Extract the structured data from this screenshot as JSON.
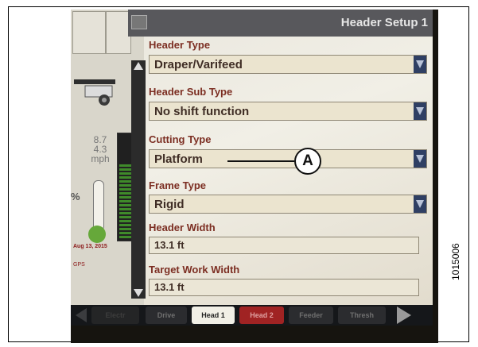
{
  "window": {
    "title": "Header Setup 1"
  },
  "gauges": {
    "speed_top": "8.7",
    "speed_bottom": "4.3",
    "speed_unit": "mph",
    "percent_partial": "%",
    "date": "Aug 13, 2015",
    "gps": "GPS"
  },
  "form": {
    "header_type": {
      "label": "Header Type",
      "value": "Draper/Varifeed"
    },
    "header_sub_type": {
      "label": "Header Sub Type",
      "value": "No shift function"
    },
    "cutting_type": {
      "label": "Cutting Type",
      "value": "Platform"
    },
    "frame_type": {
      "label": "Frame Type",
      "value": "Rigid"
    },
    "header_width": {
      "label": "Header Width",
      "value": "13.1  ft"
    },
    "target_work_width": {
      "label": "Target Work Width",
      "value": "13.1  ft"
    }
  },
  "tabs": [
    "Electr",
    "Drive",
    "Head 1",
    "Head 2",
    "Feeder",
    "Thresh"
  ],
  "active_tab": "Head 1",
  "callout": {
    "label": "A"
  },
  "figure_number": "1015006",
  "colors": {
    "label": "#7c2e22",
    "dropdown_arrow": "#2f3f63",
    "titlebar": "#58585c",
    "tab_alert": "#a02323",
    "gauge_green": "#66a83a"
  }
}
